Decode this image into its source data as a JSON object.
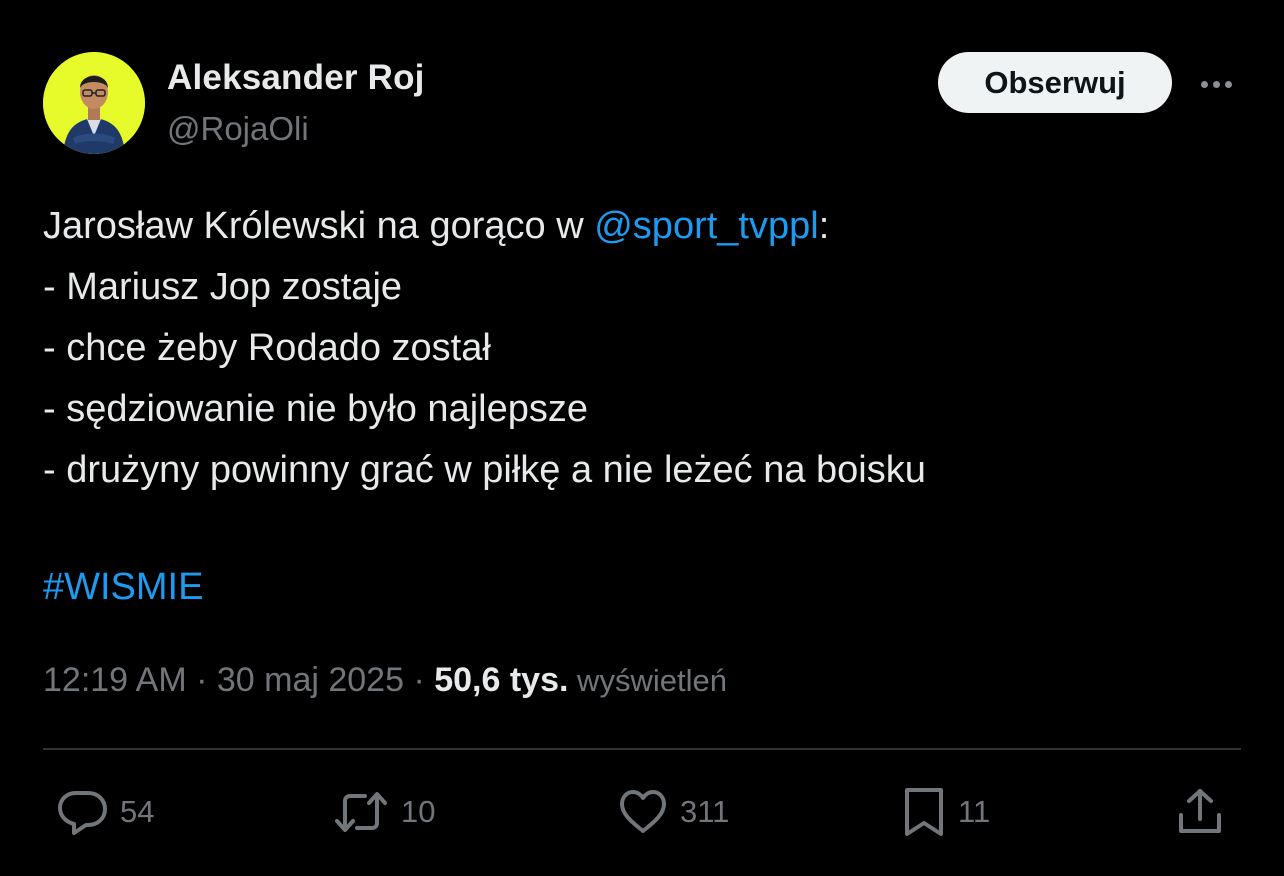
{
  "author": {
    "name": "Aleksander Roj",
    "handle": "@RojaOli"
  },
  "header": {
    "follow_label": "Obserwuj",
    "more_icon": "ellipsis-icon"
  },
  "tweet": {
    "line1_prefix": "Jarosław Królewski na gorąco w ",
    "line1_mention": "@sport_tvppl",
    "line1_suffix": ":",
    "line2": "- Mariusz Jop zostaje",
    "line3": "- chce żeby Rodado został",
    "line4": "- sędziowanie nie było najlepsze",
    "line5": "- drużyny powinny grać w piłkę a nie leżeć na boisku",
    "hashtag": "#WISMIE"
  },
  "meta": {
    "timestamp": "12:19 AM · 30 maj 2025 · ",
    "views_count": "50,6 tys.",
    "views_label": " wyświetleń"
  },
  "actions": {
    "replies": "54",
    "retweets": "10",
    "likes": "311",
    "bookmarks": "11"
  },
  "colors": {
    "background": "#000000",
    "text": "#e7e9ea",
    "secondary": "#71767b",
    "link": "#1d9bf0",
    "avatar_bg": "#e8fb2a"
  }
}
